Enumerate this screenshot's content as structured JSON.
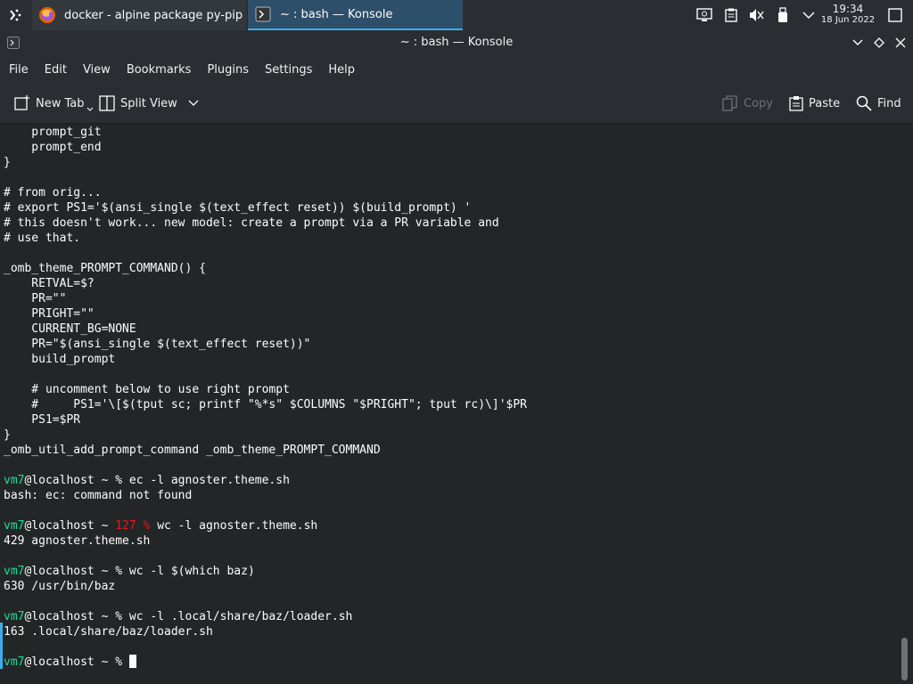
{
  "taskbar": {
    "tasks": [
      {
        "label": "docker - alpine package py-pip m...",
        "icon": "firefox-icon"
      },
      {
        "label": "~ : bash — Konsole",
        "icon": "terminal-icon"
      }
    ],
    "clock": {
      "time": "19:34",
      "date": "18 Jun 2022"
    },
    "tray_icons": [
      "display-config-icon",
      "clipboard-icon",
      "volume-muted-icon",
      "usb-icon",
      "expand-tray-icon",
      "show-desktop-icon"
    ]
  },
  "window": {
    "title": "~ : bash — Konsole",
    "buttons": [
      "minimize-icon",
      "maximize-icon",
      "close-icon"
    ]
  },
  "menubar": [
    "File",
    "Edit",
    "View",
    "Bookmarks",
    "Plugins",
    "Settings",
    "Help"
  ],
  "toolbar": {
    "new_tab": "New Tab",
    "split_view": "Split View",
    "copy": "Copy",
    "paste": "Paste",
    "find": "Find"
  },
  "colors": {
    "prompt_green": "#1cdc9a",
    "error_red": "#ed1515",
    "accent": "#3daee9"
  },
  "terminal": {
    "lines": [
      "    prompt_git",
      "    prompt_end",
      "}",
      "",
      "# from orig...",
      "# export PS1='$(ansi_single $(text_effect reset)) $(build_prompt) '",
      "# this doesn't work... new model: create a prompt via a PR variable and",
      "# use that.",
      "",
      "_omb_theme_PROMPT_COMMAND() {",
      "    RETVAL=$?",
      "    PR=\"\"",
      "    PRIGHT=\"\"",
      "    CURRENT_BG=NONE",
      "    PR=\"$(ansi_single $(text_effect reset))\"",
      "    build_prompt",
      "",
      "    # uncomment below to use right prompt",
      "    #     PS1='\\[$(tput sc; printf \"%*s\" $COLUMNS \"$PRIGHT\"; tput rc)\\]'$PR",
      "    PS1=$PR",
      "}",
      "_omb_util_add_prompt_command _omb_theme_PROMPT_COMMAND",
      ""
    ],
    "user": "vm7",
    "host": "@localhost ~ ",
    "exit_code": "127",
    "commands": [
      {
        "cmd": "ec -l agnoster.theme.sh",
        "output": "bash: ec: command not found"
      },
      {
        "cmd": "wc -l agnoster.theme.sh",
        "output": "429 agnoster.theme.sh"
      },
      {
        "cmd": "wc -l $(which baz)",
        "output": "630 /usr/bin/baz"
      },
      {
        "cmd": "wc -l .local/share/baz/loader.sh",
        "output": "163 .local/share/baz/loader.sh"
      }
    ],
    "prompt_symbol": "%"
  }
}
